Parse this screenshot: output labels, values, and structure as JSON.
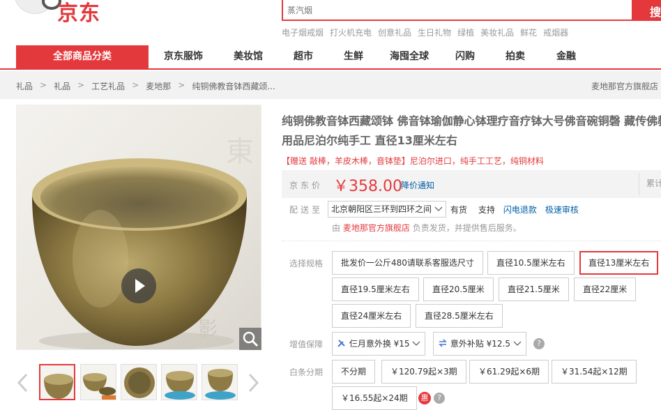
{
  "header": {
    "logo_text": "京东",
    "search_placeholder": "蒸汽烟",
    "search_button": "搜",
    "hot_words": [
      "电子烟戒烟",
      "打火机充电",
      "创意礼品",
      "生日礼物",
      "绿植",
      "美妆礼品",
      "鲜花",
      "戒烟器"
    ]
  },
  "nav": {
    "all_categories": "全部商品分类",
    "items": [
      "京东服饰",
      "美妆馆",
      "超市",
      "生鲜",
      "海囤全球",
      "闪购",
      "拍卖",
      "金融"
    ]
  },
  "breadcrumb": [
    "礼品",
    "礼品",
    "工艺礼品",
    "麦地那",
    "纯铜佛教音钵西藏颂..."
  ],
  "shop_name": "麦地那官方旗舰店",
  "product": {
    "title_line1": "纯铜佛教音钵西藏颂钵 佛音钵瑜伽静心钵理疗音疗钵大号佛音碗铜磬 藏传佛教",
    "title_line2": "用品尼泊尔纯手工 直径13厘米左右",
    "promo": "【赠送 敲棒，羊皮木棒，音钵垫】尼泊尔进口，纯手工工艺，纯铜材料",
    "price_label": "京东价",
    "price": "￥358.00",
    "price_notify": "降价通知",
    "accumulate": "累计",
    "delivery_label": "配送至",
    "delivery_address": "北京朝阳区三环到四环之间",
    "stock": "有货",
    "services": [
      "支持"
    ],
    "service_links": [
      "闪电退款",
      "极速审核"
    ],
    "fulfil_prefix": "由",
    "fulfil_shop": "麦地那官方旗舰店",
    "fulfil_suffix": "负责发货，并提供售后服务。"
  },
  "spec": {
    "label": "选择规格",
    "options": [
      "批发价一公斤480请联系客服选尺寸",
      "直径10.5厘米左右",
      "直径13厘米左右",
      "直径19.5厘米左右",
      "直径20.5厘米",
      "直径21.5厘米",
      "直径22厘米",
      "直径24厘米左右",
      "直径28.5厘米左右"
    ],
    "selected": 2
  },
  "warranty": {
    "label": "增值保障",
    "options": [
      "仨月意外换 ¥15",
      "意外补贴 ¥12.5"
    ],
    "help": "?"
  },
  "installment": {
    "label": "白条分期",
    "options": [
      "不分期",
      "￥120.79起×3期",
      "￥61.29起×6期",
      "￥31.54起×12期",
      "￥16.55起×24期"
    ],
    "hui_badge": "惠",
    "help": "?"
  },
  "colors": {
    "brand_red": "#e4393c",
    "link_blue": "#005ea7"
  }
}
